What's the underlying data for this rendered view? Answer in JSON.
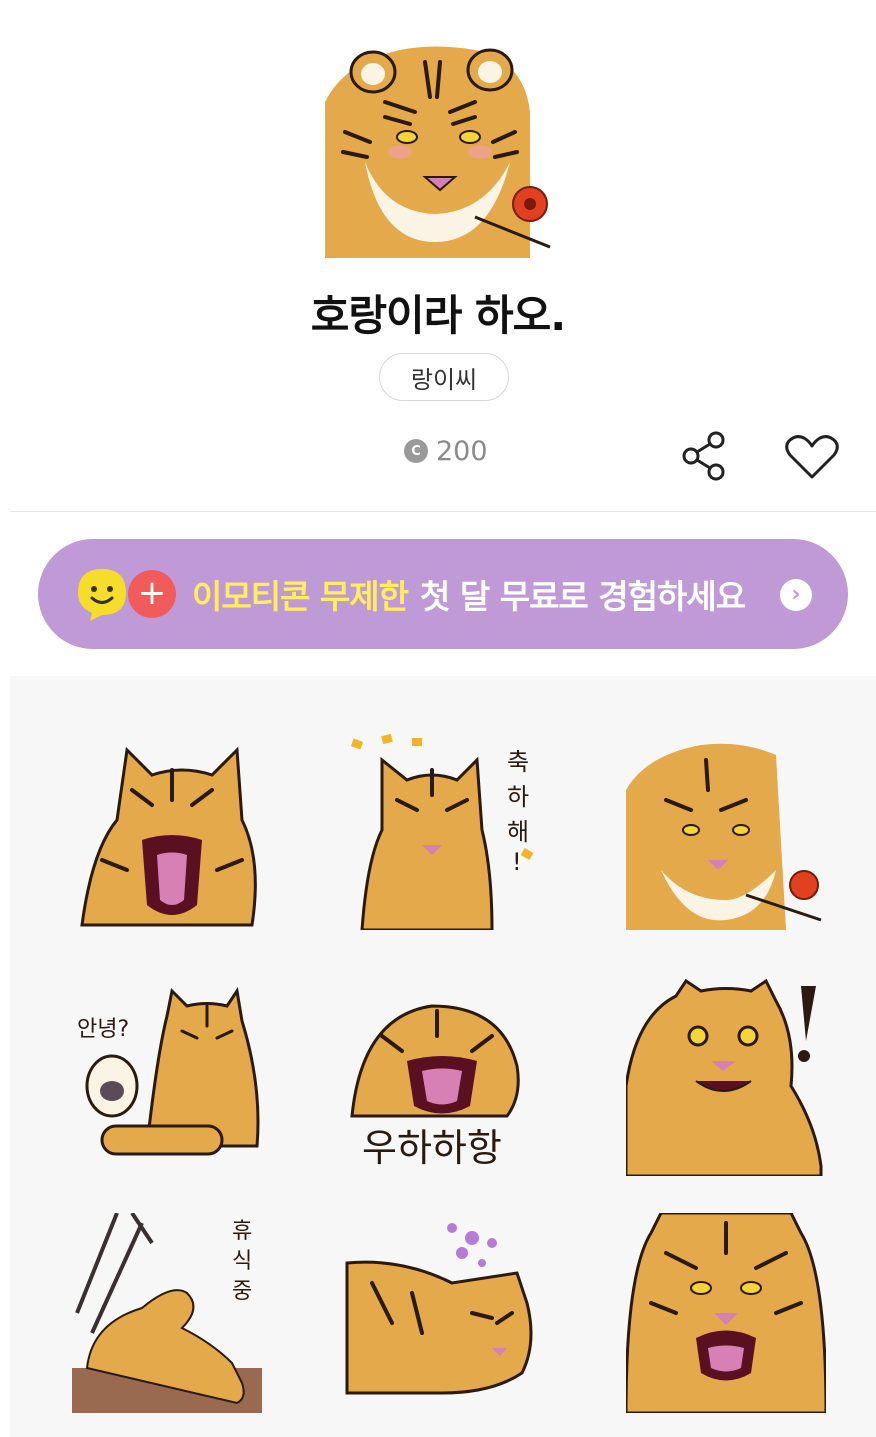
{
  "header": {
    "title": "호랑이라 하오.",
    "author": "랑이씨",
    "price": "200",
    "coin_symbol": "C",
    "hero_icon": "tiger-with-flower-icon"
  },
  "actions": {
    "share_icon": "share-icon",
    "like_icon": "heart-icon"
  },
  "promo": {
    "highlight": "이모티콘 무제한",
    "rest": "첫 달 무료로 경험하세요",
    "plus_symbol": "+",
    "arrow_symbol": "›",
    "bg_color": "#bf9ad6",
    "highlight_color": "#ffee5c",
    "plus_color": "#f25b5b"
  },
  "stickers": [
    {
      "name": "tiger-yawning",
      "caption": ""
    },
    {
      "name": "tiger-congrats",
      "caption": "축하해!"
    },
    {
      "name": "tiger-with-flower",
      "caption": ""
    },
    {
      "name": "tiger-waving",
      "caption": "안녕?"
    },
    {
      "name": "tiger-roaring",
      "caption": "우하하항"
    },
    {
      "name": "tiger-surprised",
      "caption": "!"
    },
    {
      "name": "tiger-resting",
      "caption": "휴식중"
    },
    {
      "name": "tiger-sleeping",
      "caption": ""
    },
    {
      "name": "tiger-growling",
      "caption": ""
    }
  ],
  "colors": {
    "tiger_orange": "#e3a94a",
    "stripe": "#2b1a10",
    "cream": "#fbf4e4",
    "nose_pink": "#d680b5"
  }
}
